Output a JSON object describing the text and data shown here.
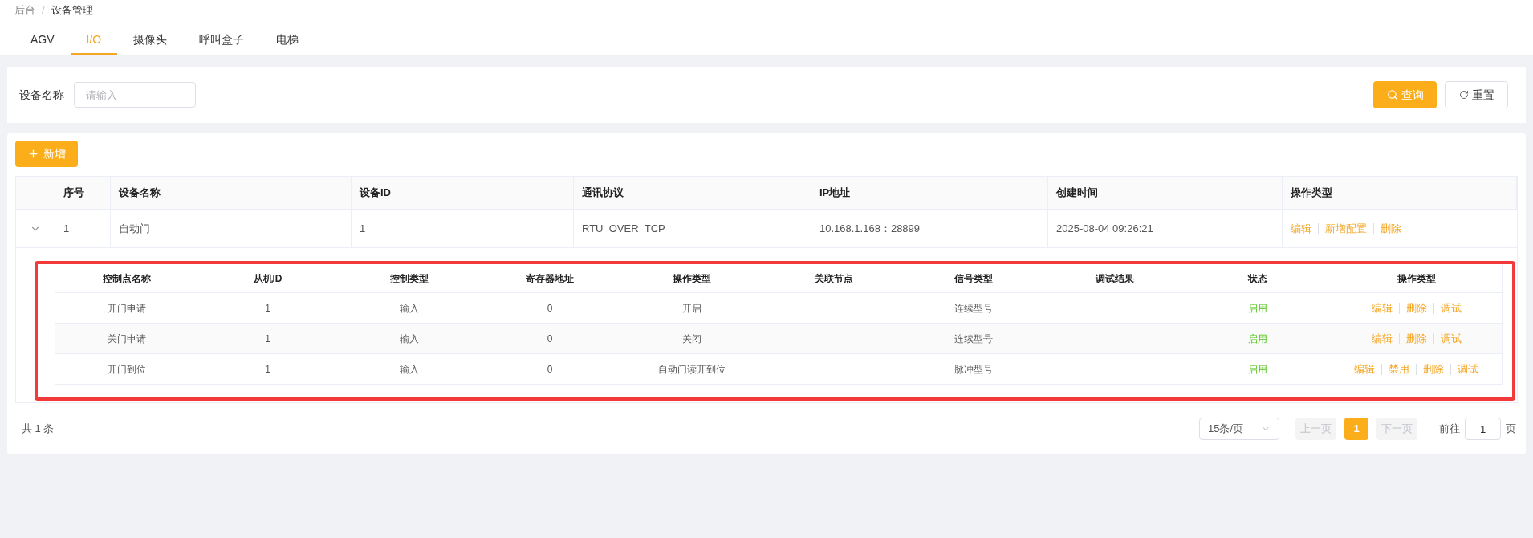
{
  "breadcrumb": {
    "items": [
      "后台",
      "设备管理"
    ],
    "separator": "/"
  },
  "tabs": [
    {
      "label": "AGV",
      "selected": false
    },
    {
      "label": "I/O",
      "selected": true
    },
    {
      "label": "摄像头",
      "selected": false
    },
    {
      "label": "呼叫盒子",
      "selected": false
    },
    {
      "label": "电梯",
      "selected": false
    }
  ],
  "search": {
    "label": "设备名称",
    "placeholder": "请输入",
    "query_button": "查询",
    "reset_button": "重置"
  },
  "add_button": "新增",
  "table": {
    "columns": [
      "序号",
      "设备名称",
      "设备ID",
      "通讯协议",
      "IP地址",
      "创建时间",
      "操作类型"
    ],
    "rows": [
      {
        "expanded": true,
        "cells": [
          "1",
          "自动门",
          "1",
          "RTU_OVER_TCP",
          "10.168.1.168：28899",
          "2025-08-04 09:26:21"
        ],
        "actions": [
          "编辑",
          "新增配置",
          "删除"
        ],
        "sub_table": {
          "columns": [
            "控制点名称",
            "从机ID",
            "控制类型",
            "寄存器地址",
            "操作类型",
            "关联节点",
            "信号类型",
            "调试结果",
            "状态",
            "操作类型"
          ],
          "rows": [
            {
              "cells": [
                "开门申请",
                "1",
                "输入",
                "0",
                "开启",
                "",
                "连续型号",
                ""
              ],
              "status": {
                "text": "启用",
                "on": true
              },
              "actions": [
                "编辑",
                "删除",
                "调试"
              ]
            },
            {
              "cells": [
                "关门申请",
                "1",
                "输入",
                "0",
                "关闭",
                "",
                "连续型号",
                ""
              ],
              "status": {
                "text": "启用",
                "on": true
              },
              "actions": [
                "编辑",
                "删除",
                "调试"
              ]
            },
            {
              "cells": [
                "开门到位",
                "1",
                "输入",
                "0",
                "自动门读开到位",
                "",
                "脉冲型号",
                ""
              ],
              "status": {
                "text": "启用",
                "on": true
              },
              "actions": [
                "编辑",
                "禁用",
                "删除",
                "调试"
              ]
            }
          ]
        }
      }
    ]
  },
  "pagination": {
    "total": "共 1 条",
    "page_size": "15条/页",
    "prev": {
      "label": "上一页",
      "disabled": true
    },
    "pages": [
      {
        "label": "1",
        "selected": true
      }
    ],
    "next": {
      "label": "下一页",
      "disabled": true
    },
    "goto_label": "前往",
    "goto_value": "1",
    "goto_suffix": "页"
  }
}
